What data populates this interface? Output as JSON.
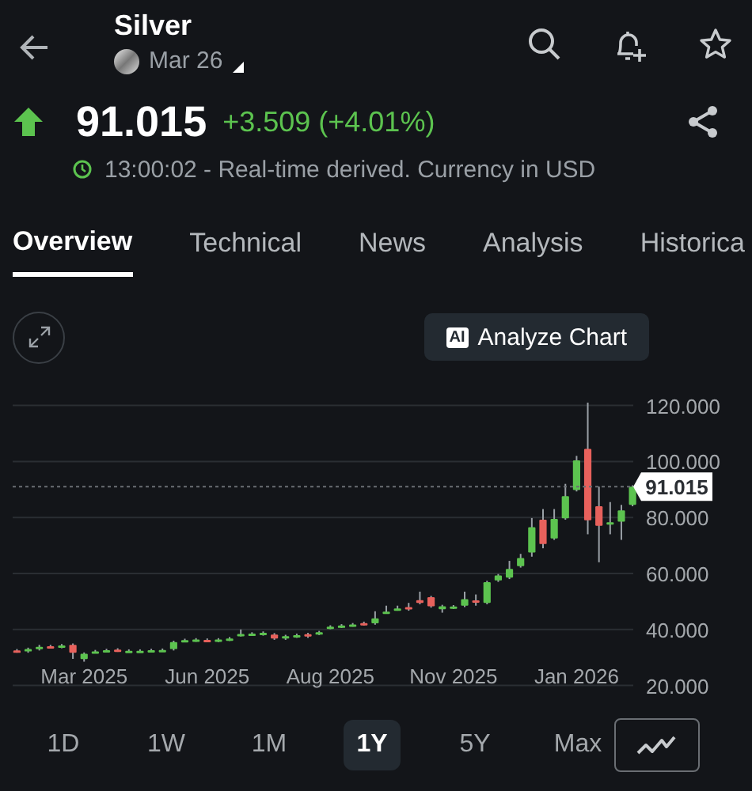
{
  "header": {
    "title": "Silver",
    "contract": "Mar 26"
  },
  "quote": {
    "rising": true,
    "price": "91.015",
    "change": "+3.509 (+4.01%)",
    "status": "13:00:02 - Real-time derived. Currency in USD"
  },
  "tabs": [
    {
      "label": "Overview",
      "selected": true
    },
    {
      "label": "Technical",
      "selected": false
    },
    {
      "label": "News",
      "selected": false
    },
    {
      "label": "Analysis",
      "selected": false
    },
    {
      "label": "Historica",
      "selected": false
    }
  ],
  "chart_toolbar": {
    "ai_badge": "AI",
    "analyze_button": "Analyze Chart"
  },
  "chart": {
    "chart_data": {
      "type": "candlestick",
      "categories": [
        null,
        null,
        null,
        null,
        null,
        null,
        "Mar 2025",
        null,
        null,
        null,
        null,
        null,
        null,
        null,
        null,
        null,
        null,
        "Jun 2025",
        null,
        null,
        null,
        null,
        null,
        null,
        null,
        null,
        null,
        null,
        "Aug 2025",
        null,
        null,
        null,
        null,
        null,
        null,
        null,
        null,
        null,
        null,
        "Nov 2025",
        null,
        null,
        null,
        null,
        null,
        null,
        null,
        null,
        null,
        null,
        "Jan 2026",
        null,
        null,
        null,
        null,
        null
      ],
      "grid": true,
      "ylim": [
        20,
        120
      ],
      "yticks": [
        {
          "value": 120,
          "label": "120.000"
        },
        {
          "value": 100,
          "label": "100.000"
        },
        {
          "value": 80,
          "label": "80.000"
        },
        {
          "value": 60,
          "label": "60.000"
        },
        {
          "value": 40,
          "label": "40.000"
        },
        {
          "value": 20,
          "label": "20.000"
        }
      ],
      "ohlc": [
        [
          32.5,
          33.0,
          31.7,
          32.2
        ],
        [
          32.2,
          33.5,
          31.7,
          33.0
        ],
        [
          33.0,
          34.5,
          32.5,
          33.8
        ],
        [
          34.0,
          34.5,
          33.4,
          33.9
        ],
        [
          33.8,
          34.8,
          33.3,
          34.3
        ],
        [
          34.5,
          35.0,
          29.5,
          31.7
        ],
        [
          29.4,
          31.8,
          28.5,
          31.3
        ],
        [
          32.0,
          32.7,
          31.5,
          32.2
        ],
        [
          32.3,
          33.1,
          31.8,
          32.6
        ],
        [
          32.8,
          33.3,
          32.0,
          32.4
        ],
        [
          32.3,
          32.9,
          31.8,
          32.4
        ],
        [
          32.3,
          32.9,
          31.8,
          32.4
        ],
        [
          32.4,
          33.1,
          31.9,
          32.6
        ],
        [
          32.6,
          33.2,
          32.1,
          32.7
        ],
        [
          33.0,
          36.0,
          32.5,
          35.5
        ],
        [
          36.0,
          36.7,
          35.5,
          36.2
        ],
        [
          36.1,
          36.9,
          35.6,
          36.4
        ],
        [
          36.3,
          36.8,
          35.5,
          36.0
        ],
        [
          36.0,
          36.9,
          35.5,
          36.4
        ],
        [
          36.4,
          37.3,
          35.9,
          36.8
        ],
        [
          38.0,
          40.0,
          37.5,
          38.4
        ],
        [
          38.3,
          39.0,
          37.8,
          38.5
        ],
        [
          38.3,
          39.3,
          37.8,
          38.8
        ],
        [
          38.2,
          38.7,
          36.3,
          36.8
        ],
        [
          36.8,
          38.1,
          36.3,
          37.6
        ],
        [
          37.5,
          38.5,
          37.0,
          38.0
        ],
        [
          38.3,
          38.8,
          37.0,
          37.9
        ],
        [
          38.5,
          39.5,
          38.0,
          39.0
        ],
        [
          40.6,
          41.5,
          40.1,
          41.0
        ],
        [
          41.0,
          41.9,
          40.5,
          41.4
        ],
        [
          41.5,
          42.3,
          41.0,
          41.8
        ],
        [
          42.3,
          42.8,
          41.4,
          41.9
        ],
        [
          42.2,
          46.5,
          41.7,
          44.0
        ],
        [
          46.2,
          48.5,
          45.7,
          46.4
        ],
        [
          47.2,
          48.5,
          46.7,
          47.5
        ],
        [
          48.0,
          49.5,
          46.7,
          47.2
        ],
        [
          50.5,
          53.5,
          49.0,
          49.5
        ],
        [
          51.5,
          52.0,
          47.8,
          48.3
        ],
        [
          47.2,
          48.8,
          46.0,
          48.3
        ],
        [
          47.8,
          48.7,
          47.3,
          48.2
        ],
        [
          48.5,
          53.5,
          48.0,
          50.8
        ],
        [
          50.4,
          52.5,
          48.5,
          50.2
        ],
        [
          49.5,
          57.4,
          49.0,
          56.9
        ],
        [
          57.5,
          59.8,
          57.0,
          59.3
        ],
        [
          58.5,
          64.5,
          58.0,
          61.6
        ],
        [
          62.6,
          67.0,
          62.1,
          65.5
        ],
        [
          67.5,
          79.8,
          66.0,
          76.5
        ],
        [
          79.2,
          83.0,
          69.0,
          70.5
        ],
        [
          72.5,
          83.0,
          72.0,
          79.5
        ],
        [
          79.7,
          92.0,
          79.2,
          87.6
        ],
        [
          89.8,
          102.0,
          89.3,
          100.4
        ],
        [
          104.5,
          121.0,
          74.0,
          79.0
        ],
        [
          84.0,
          91.0,
          64.0,
          77.0
        ],
        [
          78.2,
          85.5,
          74.0,
          78.3
        ],
        [
          78.5,
          84.5,
          72.0,
          82.5
        ],
        [
          84.5,
          91.5,
          84.0,
          91.0
        ]
      ],
      "ref_lines": [
        {
          "axis": "y",
          "value": 91.015,
          "label": "91.015"
        }
      ]
    }
  },
  "ranges": [
    {
      "label": "1D",
      "selected": false
    },
    {
      "label": "1W",
      "selected": false
    },
    {
      "label": "1M",
      "selected": false
    },
    {
      "label": "1Y",
      "selected": true
    },
    {
      "label": "5Y",
      "selected": false
    },
    {
      "label": "Max",
      "selected": false
    }
  ]
}
